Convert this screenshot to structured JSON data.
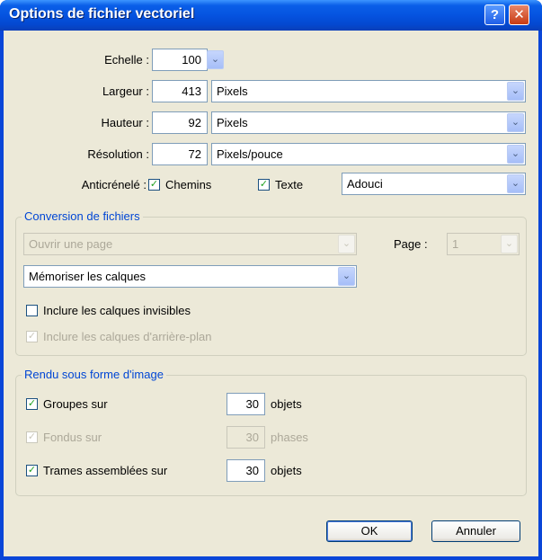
{
  "window": {
    "title": "Options de fichier vectoriel",
    "help_glyph": "?",
    "close_glyph": "✕"
  },
  "scale": {
    "label": "Echelle :",
    "value": "100"
  },
  "width": {
    "label": "Largeur :",
    "value": "413",
    "unit": "Pixels"
  },
  "height": {
    "label": "Hauteur :",
    "value": "92",
    "unit": "Pixels"
  },
  "resolution": {
    "label": "Résolution :",
    "value": "72",
    "unit": "Pixels/pouce"
  },
  "antialias": {
    "label": "Anticrénelé :",
    "paths_label": "Chemins",
    "paths_checked": true,
    "text_label": "Texte",
    "text_checked": true,
    "mode": "Adouci"
  },
  "conversion": {
    "legend": "Conversion de fichiers",
    "open_page": "Ouvrir une page",
    "page_label": "Page :",
    "page_value": "1",
    "layers_option": "Mémoriser les calques",
    "invisible_label": "Inclure les calques invisibles",
    "invisible_checked": false,
    "background_label": "Inclure les calques d'arrière-plan",
    "background_checked": true
  },
  "render": {
    "legend": "Rendu sous forme d'image",
    "groups_label": "Groupes sur",
    "groups_checked": true,
    "groups_value": "30",
    "groups_unit": "objets",
    "blends_label": "Fondus sur",
    "blends_checked": true,
    "blends_value": "30",
    "blends_unit": "phases",
    "frames_label": "Trames assemblées sur",
    "frames_checked": true,
    "frames_value": "30",
    "frames_unit": "objets"
  },
  "buttons": {
    "ok": "OK",
    "cancel": "Annuler"
  },
  "glyphs": {
    "check": "✓",
    "chevron": "⌄"
  },
  "colors": {
    "titlebar": "#0553e0",
    "face": "#ece9d8",
    "legend": "#0046d5",
    "check": "#21a121"
  }
}
